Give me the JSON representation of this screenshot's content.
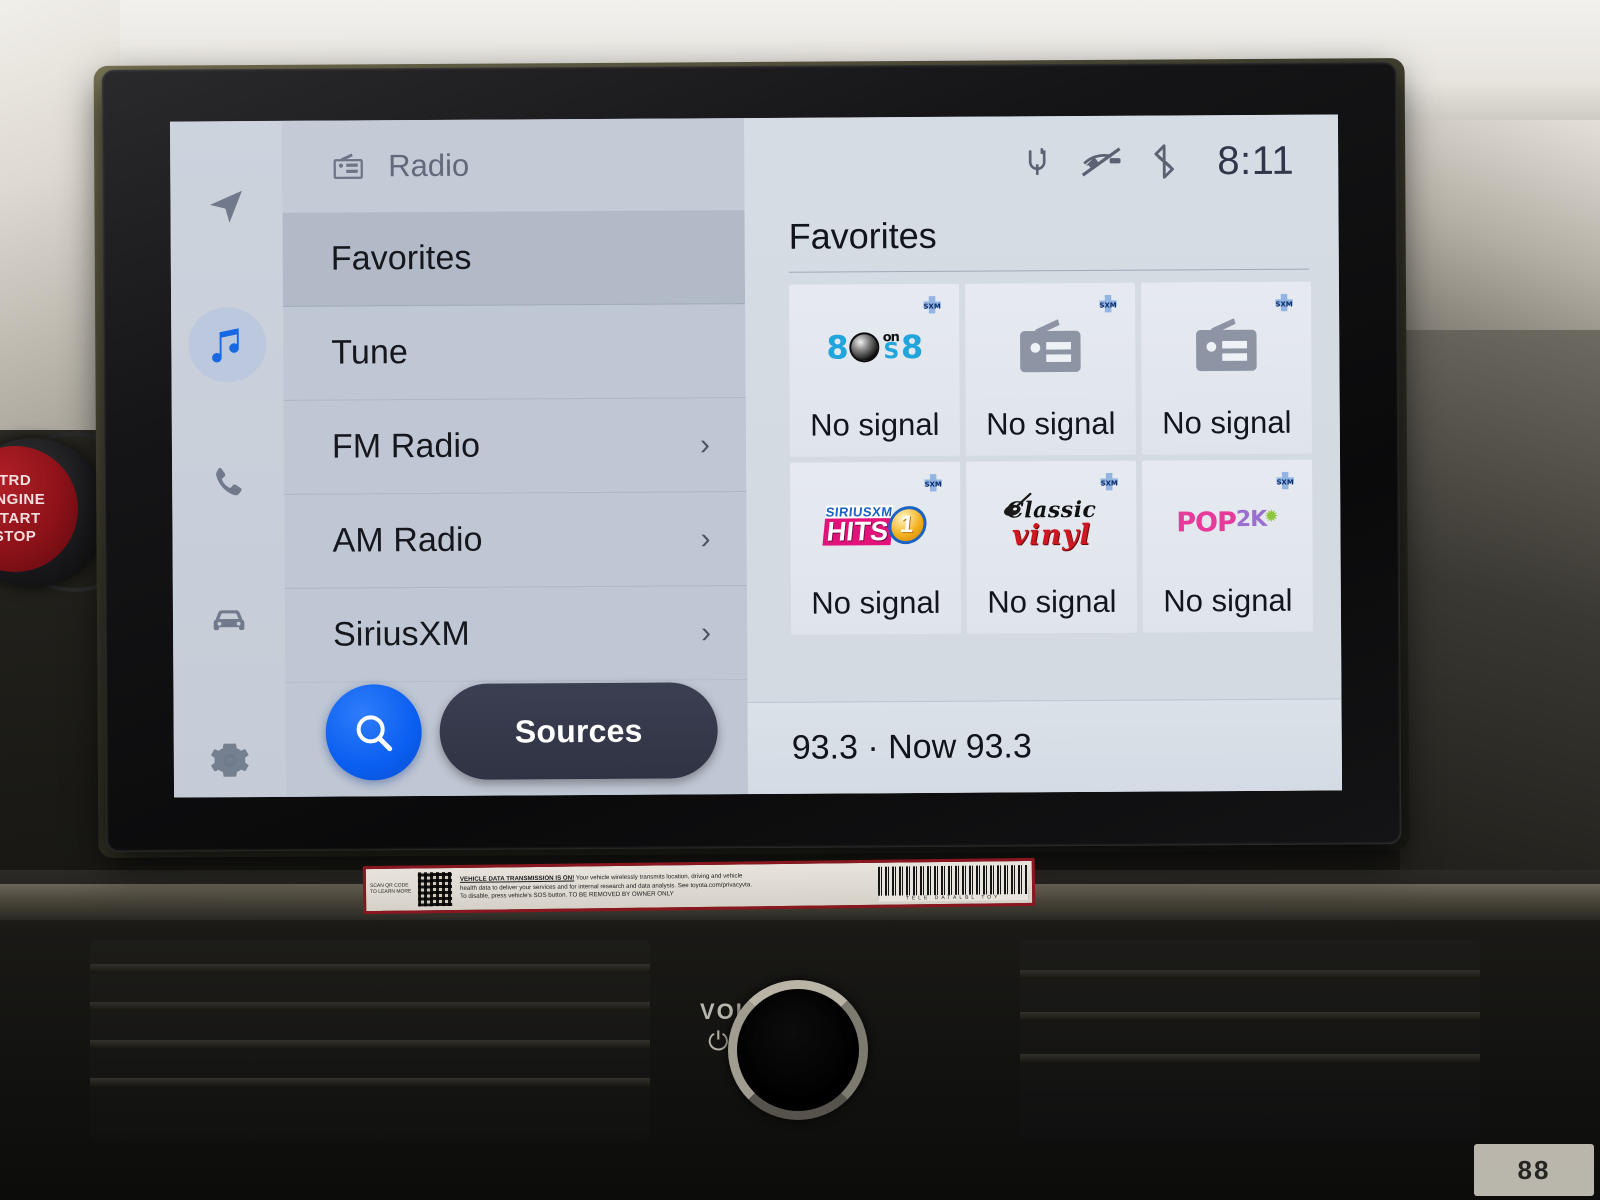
{
  "screen": {
    "rail": {
      "items": [
        {
          "name": "navigation",
          "icon": "navigation-arrow-icon",
          "active": false
        },
        {
          "name": "media",
          "icon": "music-note-icon",
          "active": true
        },
        {
          "name": "phone",
          "icon": "phone-icon",
          "active": false
        },
        {
          "name": "vehicle",
          "icon": "car-icon",
          "active": false
        },
        {
          "name": "settings",
          "icon": "gear-icon",
          "active": false
        }
      ]
    },
    "list_panel": {
      "header": {
        "icon": "radio-icon",
        "title": "Radio"
      },
      "rows": [
        {
          "label": "Favorites",
          "selected": true,
          "chevron": ""
        },
        {
          "label": "Tune",
          "selected": false,
          "chevron": ""
        },
        {
          "label": "FM Radio",
          "selected": false,
          "chevron": "›"
        },
        {
          "label": "AM Radio",
          "selected": false,
          "chevron": "›"
        },
        {
          "label": "SiriusXM",
          "selected": false,
          "chevron": "›"
        }
      ],
      "actions": {
        "search_icon": "search-icon",
        "sources_label": "Sources"
      }
    },
    "status_bar": {
      "icons": [
        "qi-wireless-charging-icon",
        "mute-call-icon",
        "bluetooth-icon"
      ],
      "clock": "8:11"
    },
    "content": {
      "title": "Favorites",
      "tiles": [
        {
          "logo": "80s-on-8",
          "badge": "sxm-badge-icon",
          "caption": "No signal"
        },
        {
          "logo": "radio-generic",
          "badge": "sxm-badge-icon",
          "caption": "No signal"
        },
        {
          "logo": "radio-generic",
          "badge": "sxm-badge-icon",
          "caption": "No signal"
        },
        {
          "logo": "siriusxm-hits-1",
          "badge": "sxm-badge-icon",
          "caption": "No signal"
        },
        {
          "logo": "classic-vinyl",
          "badge": "sxm-badge-icon",
          "caption": "No signal"
        },
        {
          "logo": "pop2k",
          "badge": "sxm-badge-icon",
          "caption": "No signal"
        }
      ],
      "now_playing": "93.3 · Now 93.3"
    },
    "logo_text": {
      "eighties": {
        "left": "8",
        "orb": "",
        "on": "on",
        "s": "S",
        "right": "8"
      },
      "hits1": {
        "brand": "SIRIUSXM",
        "word": "HITS",
        "number": "1"
      },
      "vinyl": {
        "top": "Classic",
        "bottom": "vinyl"
      },
      "pop2k": {
        "pop": "POP",
        "twok": "2K",
        "star": "✹"
      }
    }
  },
  "vehicle": {
    "start_button": {
      "line1": "TRD",
      "line2": "ENGINE",
      "line3": "START",
      "line4": "STOP"
    },
    "volume_knob": {
      "label": "VOL",
      "power_glyph": "⏻"
    },
    "sticker": {
      "scan_text": "SCAN QR CODE TO LEARN MORE",
      "headline": "VEHICLE DATA TRANSMISSION IS ON!",
      "body1": "Your vehicle wirelessly transmits location, driving and vehicle",
      "body2": "health data to deliver your services and for internal research and data analysis. See toyota.com/privacyvta.",
      "body3": "To disable, press vehicle's SOS button.    TO BE REMOVED BY OWNER ONLY",
      "barcode_text": "TELE    DATALBL    TOY"
    },
    "mini_display": "88"
  },
  "colors": {
    "accent_blue": "#0a5ef0",
    "sources_dark": "#2f3343",
    "screen_bg": "#c3cad6",
    "list_bg": "#c0c7d4",
    "selected_row": "#b2bac8",
    "content_bg": "#d6dce4",
    "tile_bg": "#e6eaf0"
  }
}
